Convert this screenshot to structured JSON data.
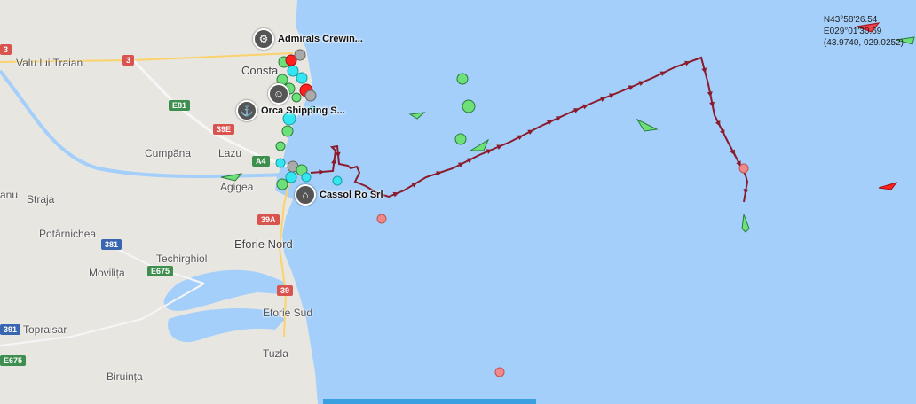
{
  "places": [
    {
      "name": "Valu lui Traian",
      "cls": "lbl"
    },
    {
      "name": "Consta",
      "cls": "lbl big"
    },
    {
      "name": "Cumpăna",
      "cls": "lbl"
    },
    {
      "name": "Lazu",
      "cls": "lbl"
    },
    {
      "name": "Straja",
      "cls": "lbl"
    },
    {
      "name": "Agigea",
      "cls": "lbl"
    },
    {
      "name": "anu",
      "cls": "lbl"
    },
    {
      "name": "Potârnichea",
      "cls": "lbl"
    },
    {
      "name": "Eforie Nord",
      "cls": "lbl big"
    },
    {
      "name": "Techirghiol",
      "cls": "lbl"
    },
    {
      "name": "Movilița",
      "cls": "lbl"
    },
    {
      "name": "Eforie Sud",
      "cls": "lbl"
    },
    {
      "name": "Topraisar",
      "cls": "lbl"
    },
    {
      "name": "Tuzla",
      "cls": "lbl"
    },
    {
      "name": "Biruința",
      "cls": "lbl"
    }
  ],
  "road_shields": [
    {
      "text": "3",
      "color": "red"
    },
    {
      "text": "3",
      "color": "red"
    },
    {
      "text": "E81",
      "color": "green"
    },
    {
      "text": "39E",
      "color": "red"
    },
    {
      "text": "A4",
      "color": "green"
    },
    {
      "text": "39A",
      "color": "red"
    },
    {
      "text": "381",
      "color": "blue"
    },
    {
      "text": "E675",
      "color": "green"
    },
    {
      "text": "39",
      "color": "red"
    },
    {
      "text": "391",
      "color": "blue"
    },
    {
      "text": "E675",
      "color": "green"
    }
  ],
  "pois": [
    {
      "name": "Admirals Crewin...",
      "icon": "gear-icon",
      "glyph": "⚙"
    },
    {
      "name": "",
      "icon": "person-icon",
      "glyph": "☺"
    },
    {
      "name": "Orca Shipping S...",
      "icon": "ship-agent-icon",
      "glyph": "⚓"
    },
    {
      "name": "Cassol Ro Srl",
      "icon": "building-icon",
      "glyph": "⌂"
    }
  ],
  "coordinates": {
    "lat": "N43°58'26.54",
    "lon": "E029°01'30.69",
    "decimal": "(43.9740, 029.0252)"
  },
  "colors": {
    "sea": "#a4cffa",
    "land": "#e8e6e1",
    "track": "#8b1a2b",
    "vessel_green": "#6ee07a",
    "vessel_cyan": "#33e6f0",
    "vessel_red": "#ff2020",
    "vessel_pink": "#f08a8a"
  }
}
